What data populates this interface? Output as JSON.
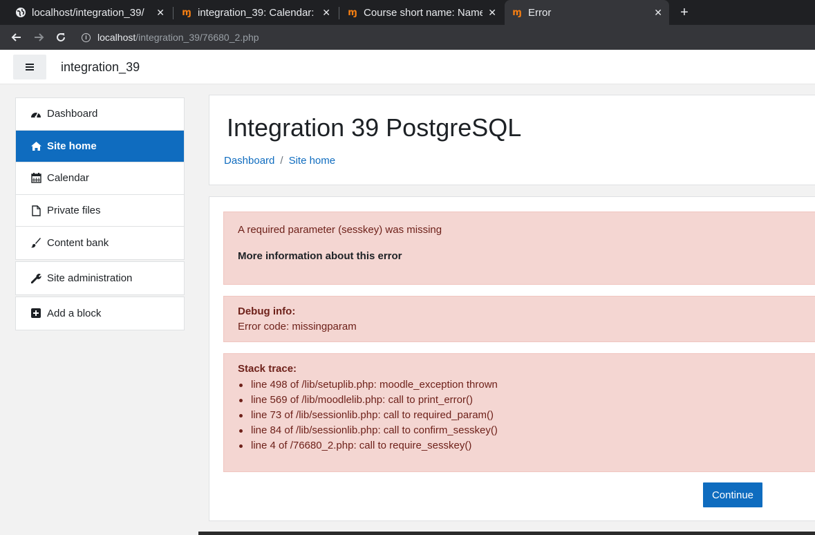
{
  "browser": {
    "tabs": [
      {
        "title": "localhost/integration_39/",
        "icon": "globe-icon",
        "active": false
      },
      {
        "title": "integration_39: Calendar:",
        "icon": "moodle-icon",
        "active": false
      },
      {
        "title": "Course short name: Name",
        "icon": "moodle-icon",
        "active": false
      },
      {
        "title": "Error",
        "icon": "moodle-icon",
        "active": true
      }
    ],
    "tab_close": "✕",
    "new_tab": "+",
    "moodle_glyph": "ɱ",
    "info_glyph": "i",
    "url_host": "localhost",
    "url_path": "/integration_39/76680_2.php"
  },
  "navbar": {
    "site_name": "integration_39"
  },
  "nav": {
    "main": [
      {
        "label": "Dashboard",
        "icon": "dashboard-icon",
        "active": false
      },
      {
        "label": "Site home",
        "icon": "home-icon",
        "active": true
      },
      {
        "label": "Calendar",
        "icon": "calendar-icon",
        "active": false
      },
      {
        "label": "Private files",
        "icon": "file-icon",
        "active": false
      },
      {
        "label": "Content bank",
        "icon": "brush-icon",
        "active": false
      }
    ],
    "admin": {
      "label": "Site administration",
      "icon": "wrench-icon"
    },
    "block": {
      "label": "Add a block",
      "icon": "plus-square-icon"
    }
  },
  "header": {
    "title": "Integration 39 PostgreSQL",
    "breadcrumb": [
      "Dashboard",
      "Site home"
    ],
    "breadcrumb_sep": "/"
  },
  "error": {
    "message": "A required parameter (sesskey) was missing",
    "more_info": "More information about this error",
    "debug_title": "Debug info:",
    "debug_code": "Error code: missingparam",
    "trace_title": "Stack trace:",
    "trace": [
      "line 498 of /lib/setuplib.php: moodle_exception thrown",
      "line 569 of /lib/moodlelib.php: call to print_error()",
      "line 73 of /lib/sessionlib.php: call to required_param()",
      "line 84 of /lib/sessionlib.php: call to confirm_sesskey()",
      "line 4 of /76680_2.php: call to require_sesskey()"
    ],
    "continue_label": "Continue"
  },
  "colors": {
    "primary": "#0f6cbf",
    "alert_bg": "#f4d6d2",
    "alert_text": "#6e211a",
    "moodle_orange": "#f98012"
  }
}
